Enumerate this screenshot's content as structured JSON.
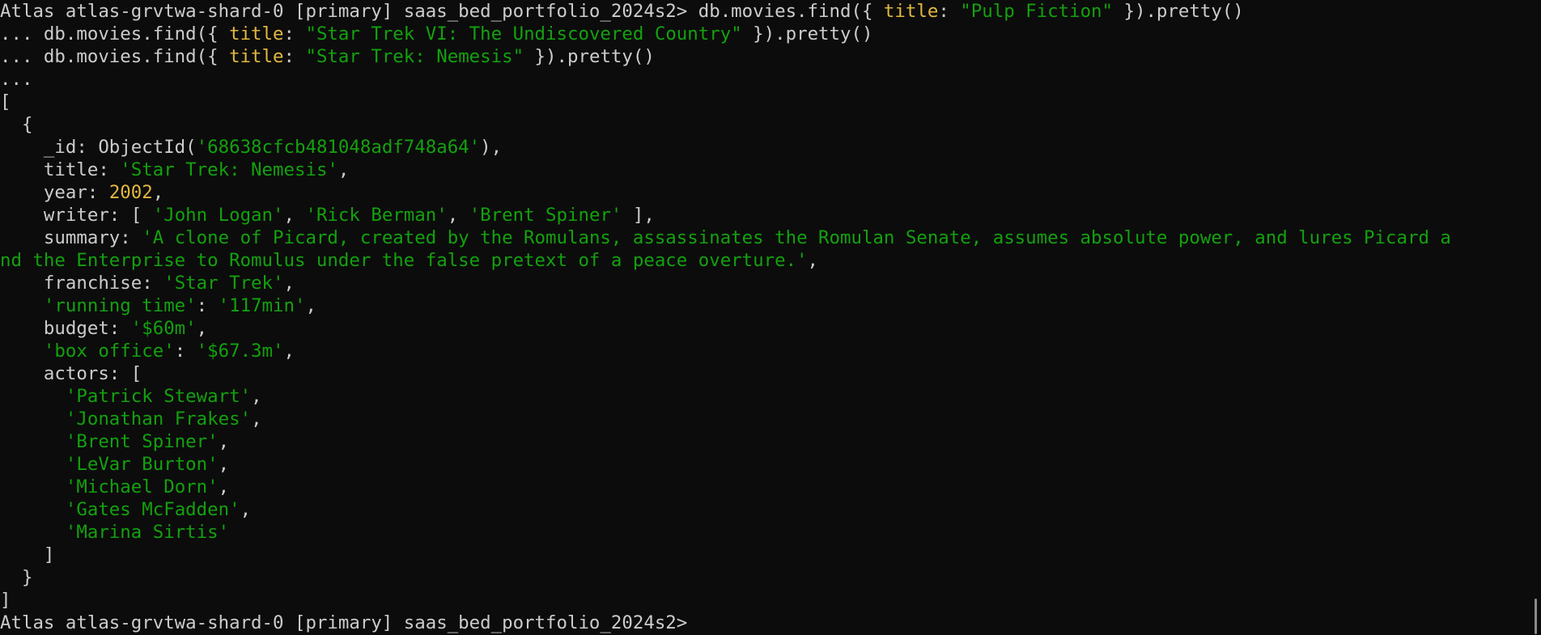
{
  "colors": {
    "background": "#0c0c0c",
    "plain": "#cccccc",
    "key": "#e2b83f",
    "string": "#13a10e",
    "number": "#e2b83f"
  },
  "lines": [
    [
      {
        "t": "Atlas atlas-grvtwa-shard-0 [primary] saas_bed_portfolio_2024s2> db.movies.find({ ",
        "c": "p"
      },
      {
        "t": "title",
        "c": "key"
      },
      {
        "t": ": ",
        "c": "p"
      },
      {
        "t": "\"Pulp Fiction\"",
        "c": "str"
      },
      {
        "t": " }).pretty()",
        "c": "p"
      }
    ],
    [
      {
        "t": "... db.movies.find({ ",
        "c": "p"
      },
      {
        "t": "title",
        "c": "key"
      },
      {
        "t": ": ",
        "c": "p"
      },
      {
        "t": "\"Star Trek VI: The Undiscovered Country\"",
        "c": "str"
      },
      {
        "t": " }).pretty()",
        "c": "p"
      }
    ],
    [
      {
        "t": "... db.movies.find({ ",
        "c": "p"
      },
      {
        "t": "title",
        "c": "key"
      },
      {
        "t": ": ",
        "c": "p"
      },
      {
        "t": "\"Star Trek: Nemesis\"",
        "c": "str"
      },
      {
        "t": " }).pretty()",
        "c": "p"
      }
    ],
    [
      {
        "t": "...",
        "c": "p"
      }
    ],
    [
      {
        "t": "[",
        "c": "p"
      }
    ],
    [
      {
        "t": "  {",
        "c": "p"
      }
    ],
    [
      {
        "t": "    _id: ObjectId(",
        "c": "p"
      },
      {
        "t": "'68638cfcb481048adf748a64'",
        "c": "str"
      },
      {
        "t": "),",
        "c": "p"
      }
    ],
    [
      {
        "t": "    title: ",
        "c": "p"
      },
      {
        "t": "'Star Trek: Nemesis'",
        "c": "str"
      },
      {
        "t": ",",
        "c": "p"
      }
    ],
    [
      {
        "t": "    year: ",
        "c": "p"
      },
      {
        "t": "2002",
        "c": "num"
      },
      {
        "t": ",",
        "c": "p"
      }
    ],
    [
      {
        "t": "    writer: [ ",
        "c": "p"
      },
      {
        "t": "'John Logan'",
        "c": "str"
      },
      {
        "t": ", ",
        "c": "p"
      },
      {
        "t": "'Rick Berman'",
        "c": "str"
      },
      {
        "t": ", ",
        "c": "p"
      },
      {
        "t": "'Brent Spiner'",
        "c": "str"
      },
      {
        "t": " ],",
        "c": "p"
      }
    ],
    [
      {
        "t": "    summary: ",
        "c": "p"
      },
      {
        "t": "'A clone of Picard, created by the Romulans, assassinates the Romulan Senate, assumes absolute power, and lures Picard a",
        "c": "str"
      }
    ],
    [
      {
        "t": "nd the Enterprise to Romulus under the false pretext of a peace overture.'",
        "c": "str"
      },
      {
        "t": ",",
        "c": "p"
      }
    ],
    [
      {
        "t": "    franchise: ",
        "c": "p"
      },
      {
        "t": "'Star Trek'",
        "c": "str"
      },
      {
        "t": ",",
        "c": "p"
      }
    ],
    [
      {
        "t": "    ",
        "c": "p"
      },
      {
        "t": "'running time'",
        "c": "str"
      },
      {
        "t": ": ",
        "c": "p"
      },
      {
        "t": "'117min'",
        "c": "str"
      },
      {
        "t": ",",
        "c": "p"
      }
    ],
    [
      {
        "t": "    budget: ",
        "c": "p"
      },
      {
        "t": "'$60m'",
        "c": "str"
      },
      {
        "t": ",",
        "c": "p"
      }
    ],
    [
      {
        "t": "    ",
        "c": "p"
      },
      {
        "t": "'box office'",
        "c": "str"
      },
      {
        "t": ": ",
        "c": "p"
      },
      {
        "t": "'$67.3m'",
        "c": "str"
      },
      {
        "t": ",",
        "c": "p"
      }
    ],
    [
      {
        "t": "    actors: [",
        "c": "p"
      }
    ],
    [
      {
        "t": "      ",
        "c": "p"
      },
      {
        "t": "'Patrick Stewart'",
        "c": "str"
      },
      {
        "t": ",",
        "c": "p"
      }
    ],
    [
      {
        "t": "      ",
        "c": "p"
      },
      {
        "t": "'Jonathan Frakes'",
        "c": "str"
      },
      {
        "t": ",",
        "c": "p"
      }
    ],
    [
      {
        "t": "      ",
        "c": "p"
      },
      {
        "t": "'Brent Spiner'",
        "c": "str"
      },
      {
        "t": ",",
        "c": "p"
      }
    ],
    [
      {
        "t": "      ",
        "c": "p"
      },
      {
        "t": "'LeVar Burton'",
        "c": "str"
      },
      {
        "t": ",",
        "c": "p"
      }
    ],
    [
      {
        "t": "      ",
        "c": "p"
      },
      {
        "t": "'Michael Dorn'",
        "c": "str"
      },
      {
        "t": ",",
        "c": "p"
      }
    ],
    [
      {
        "t": "      ",
        "c": "p"
      },
      {
        "t": "'Gates McFadden'",
        "c": "str"
      },
      {
        "t": ",",
        "c": "p"
      }
    ],
    [
      {
        "t": "      ",
        "c": "p"
      },
      {
        "t": "'Marina Sirtis'",
        "c": "str"
      }
    ],
    [
      {
        "t": "    ]",
        "c": "p"
      }
    ],
    [
      {
        "t": "  }",
        "c": "p"
      }
    ],
    [
      {
        "t": "]",
        "c": "p"
      }
    ],
    [
      {
        "t": "Atlas atlas-grvtwa-shard-0 [primary] saas_bed_portfolio_2024s2> ",
        "c": "p"
      }
    ]
  ]
}
